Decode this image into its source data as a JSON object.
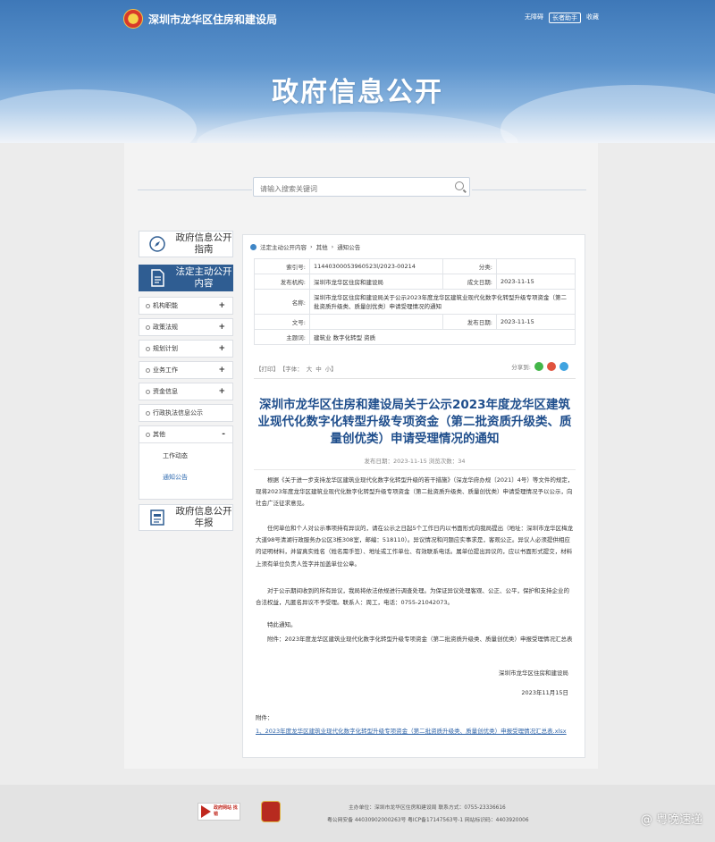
{
  "header": {
    "site_name": "深圳市龙华区住房和建设局",
    "links": [
      "无障碍",
      "长者助手",
      "收藏"
    ],
    "title": "政府信息公开"
  },
  "search": {
    "placeholder": "请输入搜索关键词"
  },
  "sidebar": {
    "guide": "政府信息公开指南",
    "active": "法定主动公开内容",
    "annual": "政府信息公开年报",
    "menu": [
      {
        "label": "机构职能",
        "toggle": "+"
      },
      {
        "label": "政策法规",
        "toggle": "+"
      },
      {
        "label": "规划计划",
        "toggle": "+"
      },
      {
        "label": "业务工作",
        "toggle": "+"
      },
      {
        "label": "资金信息",
        "toggle": "+"
      },
      {
        "label": "行政执法信息公示",
        "toggle": ""
      },
      {
        "label": "其他",
        "toggle": "-"
      }
    ],
    "submenu": [
      "工作动态",
      "通知公告"
    ]
  },
  "breadcrumb": [
    "法定主动公开内容",
    "其他",
    "通知公告"
  ],
  "info": {
    "index_label": "索引号:",
    "index_value": "11440300053960523l/2023-00214",
    "category_label": "分类:",
    "category_value": "",
    "publisher_label": "发布机构:",
    "publisher_value": "深圳市龙华区住房和建设局",
    "created_label": "成文日期:",
    "created_value": "2023-11-15",
    "name_label": "名称:",
    "name_value": "深圳市龙华区住房和建设局关于公示2023年度龙华区建筑业现代化数字化转型升级专项资金（第二批资质升级类、质量创优类）申请受理情况的通知",
    "docno_label": "文号:",
    "docno_value": "",
    "pubdate_label": "发布日期:",
    "pubdate_value": "2023-11-15",
    "subject_label": "主题词:",
    "subject_value": "建筑业 数字化转型 资质"
  },
  "tools": {
    "print": "【打印】",
    "font": "【字体：",
    "big": "大",
    "mid": "中",
    "small": "小】",
    "share": "分享到:"
  },
  "article": {
    "title": "深圳市龙华区住房和建设局关于公示2023年度龙华区建筑业现代化数字化转型升级专项资金（第二批资质升级类、质量创优类）申请受理情况的通知",
    "meta": "发布日期：2023-11-15   浏览次数：34",
    "p1": "根据《关于进一步支持龙华区建筑业现代化数字化转型升级的若干措施》（深龙华府办规〔2021〕4号）等文件的规定，现将2023年度龙华区建筑业现代化数字化转型升级专项资金（第二批资质升级类、质量创优类）申请受理情况予以公示，向社会广泛征求意见。",
    "p2": "任何单位和个人对公示事项持有异议的，请在公示之日起5个工作日内以书面形式向我局提出（地址：深圳市龙华区梅龙大道98号清湖行政服务办公区3栋308室，邮编：518110）。异议情况和问题应实事求是，客观公正。异议人必须提供相应的证明材料，并留真实姓名（姓名需手签）、地址或工作单位、有效联系电话。属单位提出异议的，应以书面形式提交，材料上须有单位负责人签字并加盖单位公章。",
    "p3": "对于公示期间收到的所有异议，我局将依法依规进行调查处理。为保证异议处理客观、公正、公平，保护和支持企业的合法权益，凡匿名异议不予受理。联系人：周工，电话：0755-21042073。",
    "p4": "特此通知。",
    "p5": "附件：2023年度龙华区建筑业现代化数字化转型升级专项资金（第二批资质升级类、质量创优类）申报受理情况汇总表",
    "signer": "深圳市龙华区住房和建设局",
    "date": "2023年11月15日",
    "attach_label": "附件：",
    "attach_link": "1、2023年度龙华区建筑业现代化数字化转型升级专项资金（第二批资质升级类、质量创优类）申报受理情况汇总表.xlsx"
  },
  "footer": {
    "badge": "政府网站 找错",
    "line1": "主办单位：深圳市龙华区住房和建设局    联系方式：0755-23336616",
    "line2": "粤公网安备 44030902000263号  粤ICP备17147563号-1  网站标识码：4403920006"
  },
  "watermark": "@ 粤晚速递"
}
